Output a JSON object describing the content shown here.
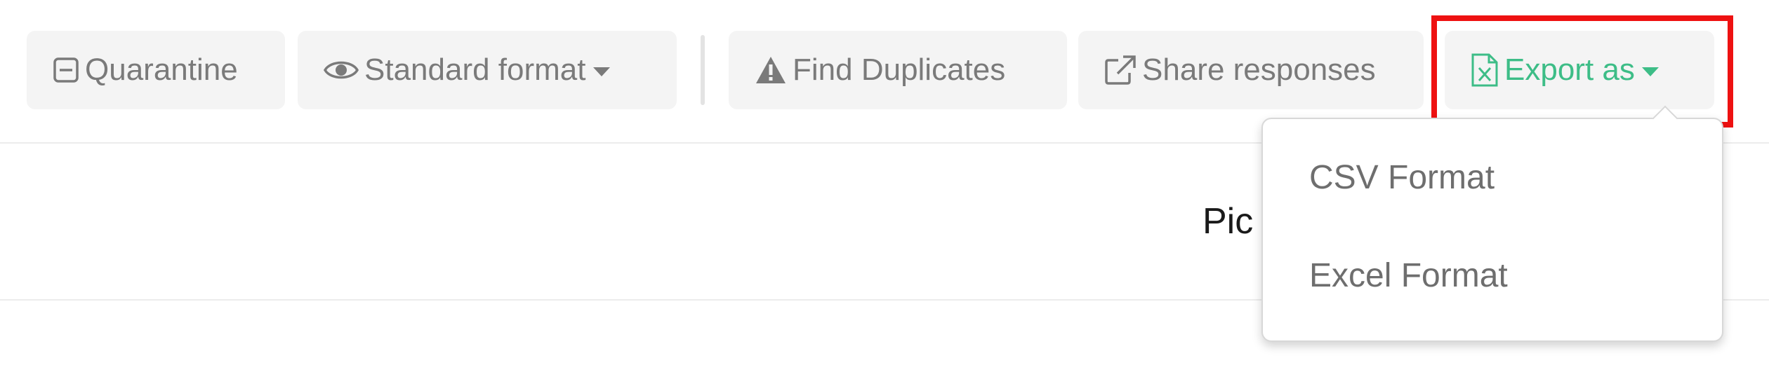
{
  "toolbar": {
    "quarantine": {
      "label": "Quarantine",
      "icon": "minus-square-icon"
    },
    "standard_format": {
      "label": "Standard format",
      "icon": "eye-icon"
    },
    "find_duplicates": {
      "label": "Find Duplicates",
      "icon": "warning-icon"
    },
    "share_responses": {
      "label": "Share responses",
      "icon": "external-link-icon"
    },
    "export_as": {
      "label": "Export as",
      "icon": "file-excel-icon",
      "color": "#3dbd87"
    }
  },
  "export_menu": {
    "items": [
      "CSV Format",
      "Excel Format"
    ]
  },
  "main": {
    "partial_text": "Pic"
  },
  "colors": {
    "highlight": "#ee1111",
    "accent": "#3dbd87",
    "button_bg": "#f4f4f4"
  }
}
